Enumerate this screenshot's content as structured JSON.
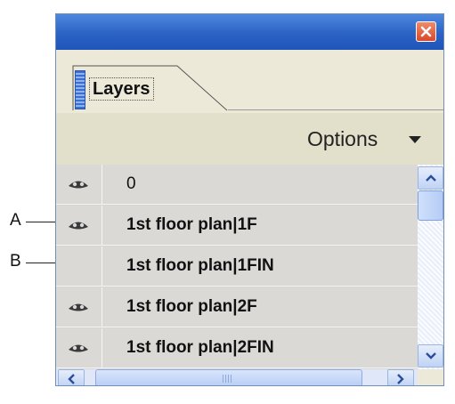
{
  "callouts": [
    {
      "letter": "A",
      "row": 1
    },
    {
      "letter": "B",
      "row": 2
    }
  ],
  "panel": {
    "close_icon": "close-x-icon",
    "tab": {
      "label": "Layers",
      "grip_icon": "panel-grip-icon"
    },
    "options": {
      "label": "Options",
      "arrow_icon": "dropdown-triangle-icon"
    },
    "layers": [
      {
        "name": "0",
        "visible": true
      },
      {
        "name": "1st floor plan|1F",
        "visible": true
      },
      {
        "name": "1st floor plan|1FIN",
        "visible": false
      },
      {
        "name": "1st floor plan|2F",
        "visible": true
      },
      {
        "name": "1st floor plan|2FIN",
        "visible": true
      }
    ],
    "scroll_icons": {
      "up": "scroll-up-icon",
      "down": "scroll-down-icon",
      "left": "scroll-left-icon",
      "right": "scroll-right-icon"
    },
    "colors": {
      "titlebar": "#2b62c4",
      "close_button": "#d8492a",
      "panel_bg": "#ece9d8",
      "row_bg": "#dad9d5"
    }
  }
}
